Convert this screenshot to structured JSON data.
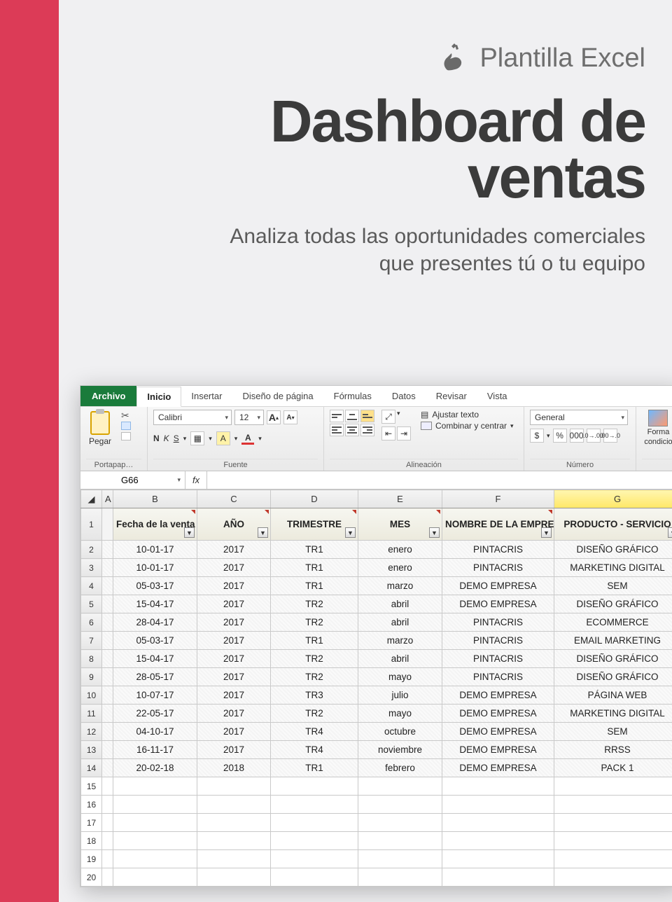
{
  "brand": {
    "tagline": "Plantilla Excel"
  },
  "title_line1": "Dashboard de",
  "title_line2": "ventas",
  "subtitle_line1": "Analiza todas las oportunidades comerciales",
  "subtitle_line2": "que presentes tú o tu equipo",
  "excel": {
    "tabs": {
      "file": "Archivo",
      "home": "Inicio",
      "insert": "Insertar",
      "layout": "Diseño de página",
      "formulas": "Fórmulas",
      "data": "Datos",
      "review": "Revisar",
      "view": "Vista"
    },
    "ribbon": {
      "paste": "Pegar",
      "clipboard_group": "Portapap…",
      "font_name": "Calibri",
      "font_size": "12",
      "font_group": "Fuente",
      "wrap_text": "Ajustar texto",
      "merge": "Combinar y centrar",
      "align_group": "Alineación",
      "number_format": "General",
      "number_group": "Número",
      "cond_format_1": "Forma",
      "cond_format_2": "condicio"
    },
    "bold": "N",
    "italic": "K",
    "underline": "S",
    "namebox": "G66",
    "fx_label": "fx",
    "columns": [
      "A",
      "B",
      "C",
      "D",
      "E",
      "F",
      "G"
    ],
    "filter_headers": [
      "Fecha de la venta",
      "AÑO",
      "TRIMESTRE",
      "MES",
      "NOMBRE DE LA EMPRESA",
      "PRODUCTO - SERVICIO"
    ],
    "rows": [
      [
        "10-01-17",
        "2017",
        "TR1",
        "enero",
        "PINTACRIS",
        "DISEÑO GRÁFICO"
      ],
      [
        "10-01-17",
        "2017",
        "TR1",
        "enero",
        "PINTACRIS",
        "MARKETING DIGITAL"
      ],
      [
        "05-03-17",
        "2017",
        "TR1",
        "marzo",
        "DEMO EMPRESA",
        "SEM"
      ],
      [
        "15-04-17",
        "2017",
        "TR2",
        "abril",
        "DEMO EMPRESA",
        "DISEÑO GRÁFICO"
      ],
      [
        "28-04-17",
        "2017",
        "TR2",
        "abril",
        "PINTACRIS",
        "ECOMMERCE"
      ],
      [
        "05-03-17",
        "2017",
        "TR1",
        "marzo",
        "PINTACRIS",
        "EMAIL MARKETING"
      ],
      [
        "15-04-17",
        "2017",
        "TR2",
        "abril",
        "PINTACRIS",
        "DISEÑO GRÁFICO"
      ],
      [
        "28-05-17",
        "2017",
        "TR2",
        "mayo",
        "PINTACRIS",
        "DISEÑO GRÁFICO"
      ],
      [
        "10-07-17",
        "2017",
        "TR3",
        "julio",
        "DEMO EMPRESA",
        "PÁGINA WEB"
      ],
      [
        "22-05-17",
        "2017",
        "TR2",
        "mayo",
        "DEMO EMPRESA",
        "MARKETING DIGITAL"
      ],
      [
        "04-10-17",
        "2017",
        "TR4",
        "octubre",
        "DEMO EMPRESA",
        "SEM"
      ],
      [
        "16-11-17",
        "2017",
        "TR4",
        "noviembre",
        "DEMO EMPRESA",
        "RRSS"
      ],
      [
        "20-02-18",
        "2018",
        "TR1",
        "febrero",
        "DEMO EMPRESA",
        "PACK 1"
      ]
    ],
    "empty_row_start": 15,
    "empty_row_end": 20
  }
}
